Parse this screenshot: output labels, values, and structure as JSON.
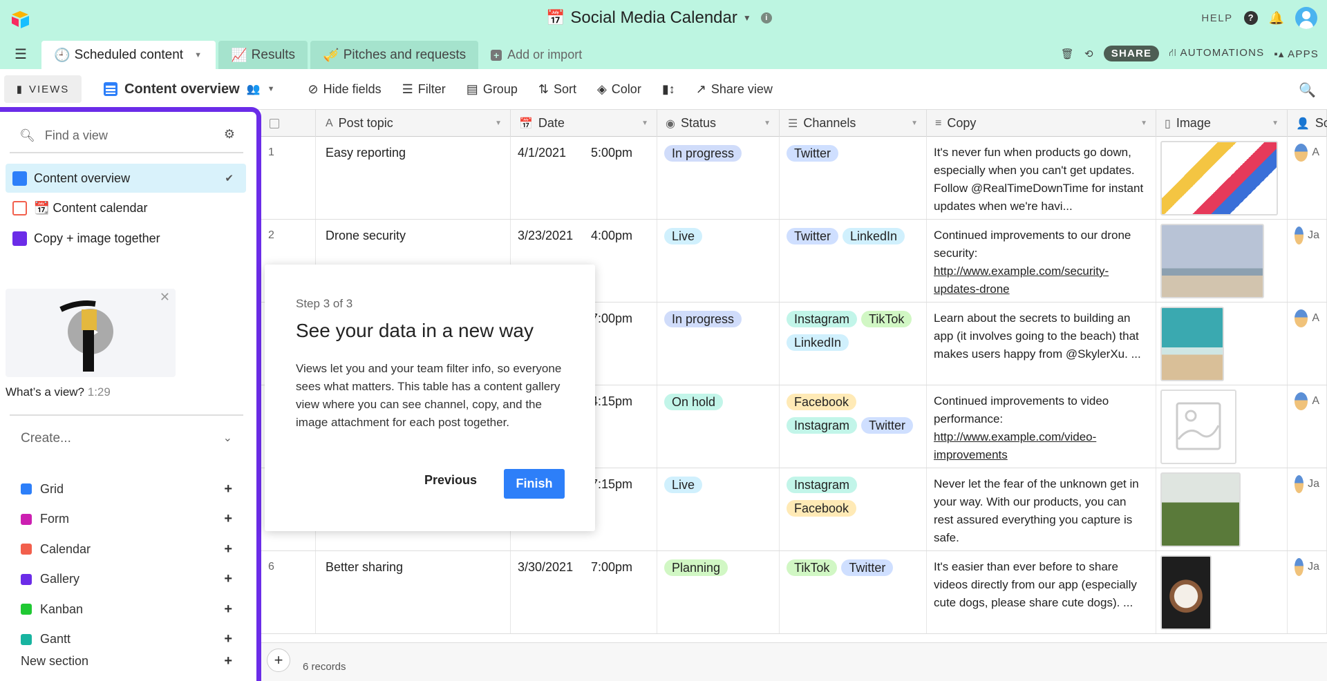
{
  "app": {
    "title": "Social Media Calendar",
    "help": "HELP"
  },
  "tabs": [
    {
      "label": "Scheduled content",
      "icon": "clock-icon"
    },
    {
      "label": "Results",
      "icon": "chart-icon"
    },
    {
      "label": "Pitches and requests",
      "icon": "pitch-icon"
    }
  ],
  "add_import": "Add or import",
  "tab_actions": {
    "share": "SHARE",
    "automations": "AUTOMATIONS",
    "apps": "APPS"
  },
  "toolbar": {
    "views": "VIEWS",
    "view_name": "Content overview",
    "hide_fields": "Hide fields",
    "filter": "Filter",
    "group": "Group",
    "sort": "Sort",
    "color": "Color",
    "share_view": "Share view"
  },
  "sidebar": {
    "find_placeholder": "Find a view",
    "views": [
      {
        "label": "Content overview",
        "color": "#2d7ff9"
      },
      {
        "label": "📆 Content calendar",
        "color": "#ef3061"
      },
      {
        "label": "Copy + image together",
        "color": "#6b2ce8"
      }
    ],
    "video_title": "What’s a view?",
    "video_duration": "1:29",
    "create_label": "Create...",
    "create_items": [
      {
        "label": "Grid",
        "color": "#2d7ff9"
      },
      {
        "label": "Form",
        "color": "#cc1fb1"
      },
      {
        "label": "Calendar",
        "color": "#f25f4c"
      },
      {
        "label": "Gallery",
        "color": "#6b2ce8"
      },
      {
        "label": "Kanban",
        "color": "#20c933"
      },
      {
        "label": "Gantt",
        "color": "#18b4a0"
      }
    ],
    "new_section": "New section"
  },
  "columns": [
    "Post topic",
    "Date",
    "Status",
    "Channels",
    "Copy",
    "Image",
    "So"
  ],
  "status_colors": {
    "In progress": "#d0dcfa",
    "Live": "#d0f0fd",
    "On hold": "#c2f5e9",
    "Planning": "#d1f7c4"
  },
  "channel_colors": {
    "Twitter": "#cfdfff",
    "LinkedIn": "#d0f0fd",
    "Instagram": "#c2f5e9",
    "TikTok": "#d1f7c4",
    "Facebook": "#ffeab6"
  },
  "rows": [
    {
      "n": "1",
      "topic": "Easy reporting",
      "date": "4/1/2021",
      "time": "5:00pm",
      "status": "In progress",
      "channels": [
        "Twitter"
      ],
      "copy": "It's never fun when products go down, especially when you can't get updates. Follow @RealTimeDownTime for instant updates when we're havi...",
      "link": "",
      "image": "illustration",
      "collab": "A"
    },
    {
      "n": "2",
      "topic": "Drone security",
      "date": "3/23/2021",
      "time": "4:00pm",
      "status": "Live",
      "channels": [
        "Twitter",
        "LinkedIn"
      ],
      "copy": "Continued improvements to our drone security:",
      "link": "http://www.example.com/security-updates-drone",
      "image": "drone",
      "collab": "Ja"
    },
    {
      "n": "",
      "topic": "",
      "date": "",
      "time": "7:00pm",
      "status": "In progress",
      "channels": [
        "Instagram",
        "TikTok",
        "LinkedIn"
      ],
      "copy": "Learn about the secrets to building an app (it involves going to the beach) that makes users happy from @SkylerXu. ...",
      "link": "",
      "image": "beach",
      "collab": "A"
    },
    {
      "n": "",
      "topic": "",
      "date": "",
      "time": "4:15pm",
      "status": "On hold",
      "channels": [
        "Facebook",
        "Instagram",
        "Twitter"
      ],
      "copy": "Continued improvements to video performance:",
      "link": "http://www.example.com/video-improvements",
      "image": "placeholder",
      "collab": "A"
    },
    {
      "n": "",
      "topic": "",
      "date": "",
      "time": "7:15pm",
      "status": "Live",
      "channels": [
        "Instagram",
        "Facebook"
      ],
      "copy": "Never let the fear of the unknown get in your way. With our products, you can rest assured everything you capture is safe.",
      "link": "",
      "image": "bicycle",
      "collab": "Ja"
    },
    {
      "n": "6",
      "topic": "Better sharing",
      "date": "3/30/2021",
      "time": "7:00pm",
      "status": "Planning",
      "channels": [
        "TikTok",
        "Twitter"
      ],
      "copy": "It's easier than ever before to share videos directly from our app (especially cute dogs, please share cute dogs). ...",
      "link": "",
      "image": "dog",
      "collab": "Ja"
    }
  ],
  "footer": {
    "records": "6 records"
  },
  "popup": {
    "step": "Step 3 of 3",
    "title": "See your data in a new way",
    "body": "Views let you and your team filter info, so everyone sees what matters. This table has a content gallery view where you can see channel, copy, and the image attachment for each post together.",
    "previous": "Previous",
    "finish": "Finish"
  }
}
